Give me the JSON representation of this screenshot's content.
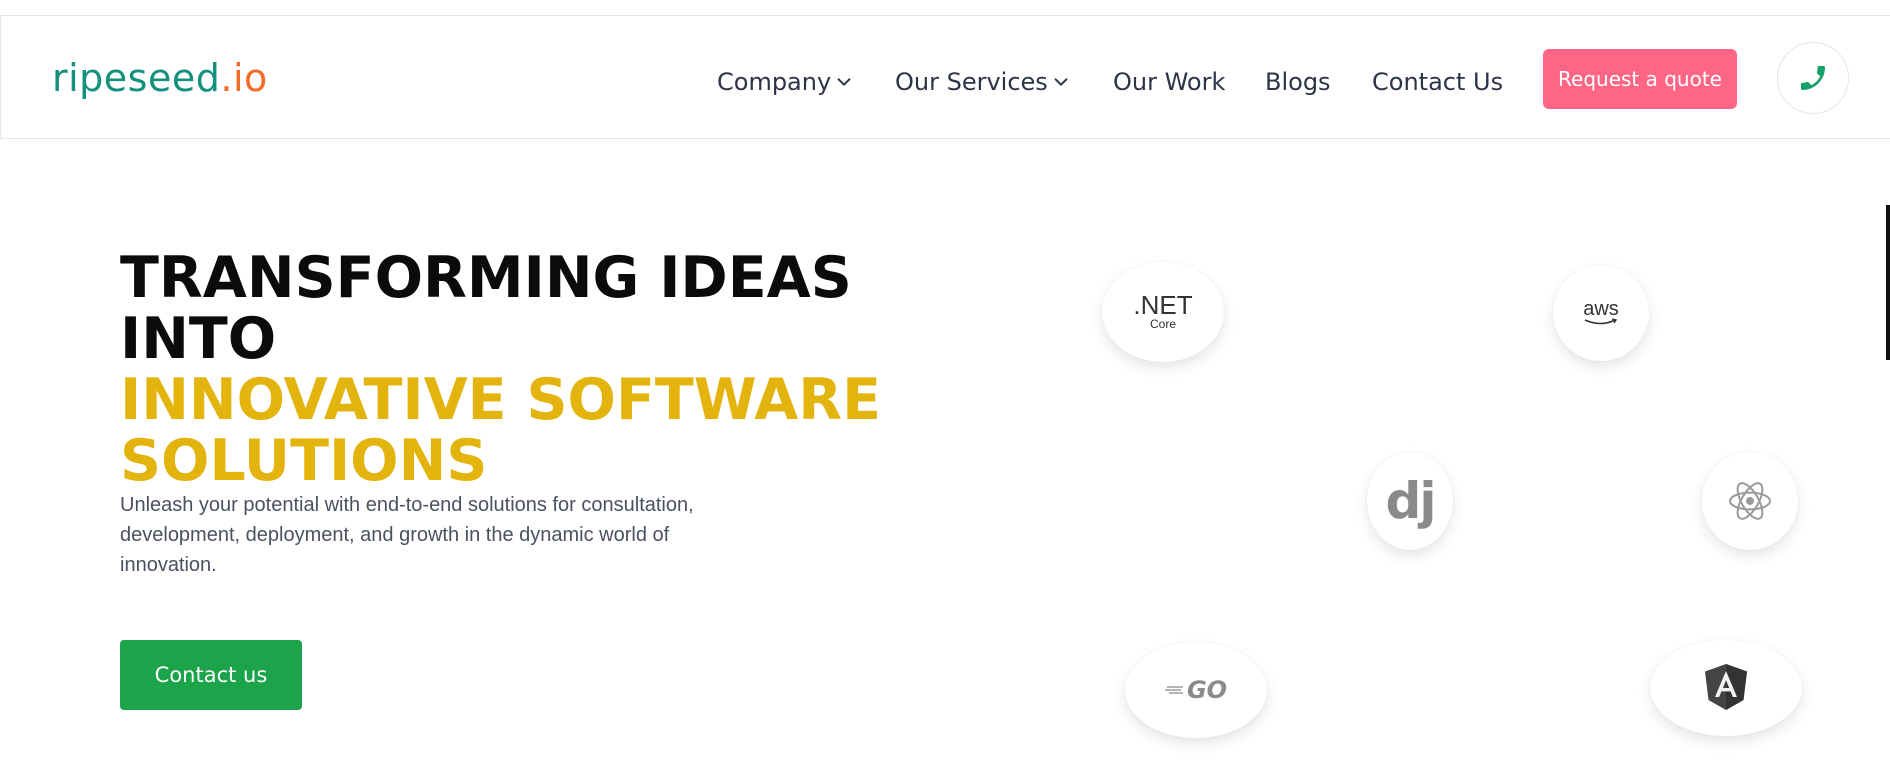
{
  "header": {
    "logo": {
      "brand": "ripeseed",
      "dot": ".",
      "tld": "io"
    },
    "nav": [
      {
        "label": "Company",
        "has_dropdown": true
      },
      {
        "label": "Our Services",
        "has_dropdown": true
      },
      {
        "label": "Our Work",
        "has_dropdown": false
      },
      {
        "label": "Blogs",
        "has_dropdown": false
      },
      {
        "label": "Contact Us",
        "has_dropdown": false
      }
    ],
    "quote_button": "Request a quote",
    "phone_icon": "phone-icon"
  },
  "hero": {
    "title_line1": "TRANSFORMING IDEAS INTO",
    "title_line2": "INNOVATIVE SOFTWARE",
    "title_line3": "SOLUTIONS",
    "description": "Unleash your potential with end-to-end solutions for consultation, development, deployment, and growth in the dynamic world of innovation.",
    "cta": "Contact us"
  },
  "tech_logos": {
    "dotnet": {
      "main": ".NET",
      "sub": "Core"
    },
    "aws": {
      "main": "aws"
    },
    "django": {
      "main": "dj"
    },
    "react": {
      "icon": "react-icon"
    },
    "go": {
      "main": "GO"
    },
    "angular": {
      "icon": "angular-icon"
    }
  },
  "colors": {
    "brand_teal": "#14907f",
    "brand_orange": "#f26b2a",
    "accent_yellow": "#e4b40e",
    "quote_pink": "#ff6584",
    "cta_green": "#1ca44a",
    "phone_green": "#14a06a"
  }
}
